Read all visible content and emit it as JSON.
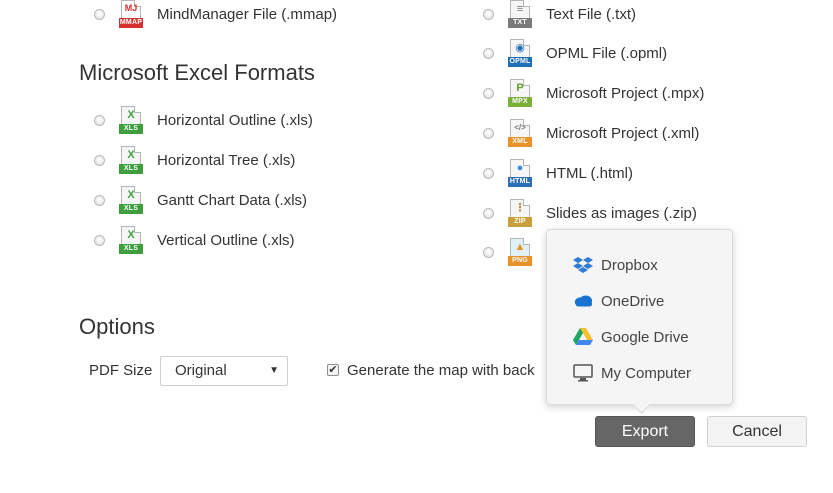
{
  "sections": {
    "excel_heading": "Microsoft Excel Formats",
    "options_heading": "Options"
  },
  "formats_left_top": [
    {
      "label": "MindManager File (.mmap)",
      "tag": "MMAP",
      "glyph": "MJ"
    }
  ],
  "excel_formats": [
    {
      "label": "Horizontal Outline (.xls)",
      "tag": "XLS",
      "glyph": "X"
    },
    {
      "label": "Horizontal Tree (.xls)",
      "tag": "XLS",
      "glyph": "X"
    },
    {
      "label": "Gantt Chart Data (.xls)",
      "tag": "XLS",
      "glyph": "X"
    },
    {
      "label": "Vertical Outline (.xls)",
      "tag": "XLS",
      "glyph": "X"
    }
  ],
  "formats_right": [
    {
      "label": "Text File (.txt)",
      "tag": "TXT",
      "glyph": "≡"
    },
    {
      "label": "OPML File (.opml)",
      "tag": "OPML",
      "glyph": "◉"
    },
    {
      "label": "Microsoft Project (.mpx)",
      "tag": "MPX",
      "glyph": "P"
    },
    {
      "label": "Microsoft Project (.xml)",
      "tag": "XML",
      "glyph": "</>"
    },
    {
      "label": "HTML (.html)",
      "tag": "HTML",
      "glyph": "●"
    },
    {
      "label": "Slides as images (.zip)",
      "tag": "ZIP",
      "glyph": "⋮"
    },
    {
      "label": "",
      "tag": "PNG",
      "glyph": "▲"
    }
  ],
  "options": {
    "pdf_size_label": "PDF Size",
    "pdf_size_value": "Original",
    "generate_label": "Generate the map with back",
    "generate_checked": "✔"
  },
  "destinations": [
    {
      "label": "Dropbox",
      "icon": "dropbox-icon"
    },
    {
      "label": "OneDrive",
      "icon": "onedrive-icon"
    },
    {
      "label": "Google Drive",
      "icon": "google-drive-icon"
    },
    {
      "label": "My Computer",
      "icon": "computer-icon"
    }
  ],
  "buttons": {
    "export": "Export",
    "cancel": "Cancel"
  },
  "colors": {
    "xls_green": "#3f9e3f",
    "mmap_red": "#d6302f",
    "export_bg": "#666666",
    "accent_blue": "#2f7bd6"
  }
}
